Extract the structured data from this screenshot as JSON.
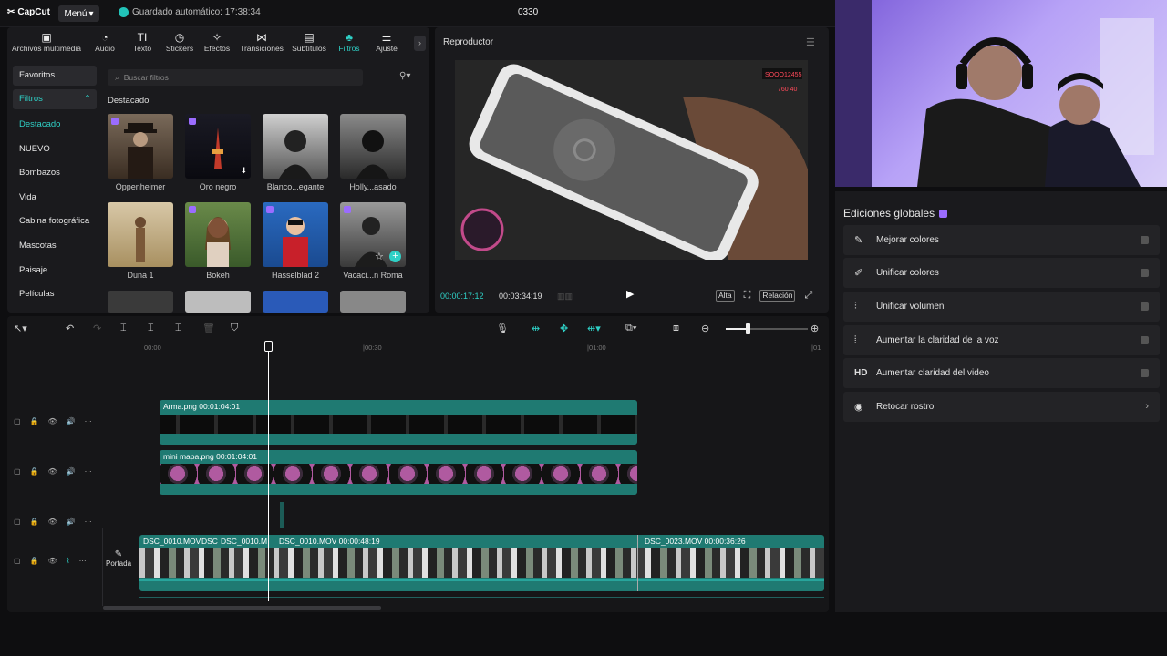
{
  "app": {
    "logo": "CapCut",
    "menu": "Menú",
    "save_status": "Guardado automático: 17:38:34",
    "project": "0330"
  },
  "toolbar": [
    {
      "label": "Archivos multimedia",
      "icon": "media-icon"
    },
    {
      "label": "Audio",
      "icon": "audio-icon"
    },
    {
      "label": "Texto",
      "icon": "text-icon"
    },
    {
      "label": "Stickers",
      "icon": "sticker-icon"
    },
    {
      "label": "Efectos",
      "icon": "effects-icon"
    },
    {
      "label": "Transiciones",
      "icon": "transition-icon"
    },
    {
      "label": "Subtítulos",
      "icon": "subtitle-icon"
    },
    {
      "label": "Filtros",
      "icon": "filter-icon"
    },
    {
      "label": "Ajuste",
      "icon": "adjust-icon"
    }
  ],
  "sidebar": [
    "Favoritos",
    "Filtros",
    "Destacado",
    "NUEVO",
    "Bombazos",
    "Vida",
    "Cabina fotográfica",
    "Mascotas",
    "Paisaje",
    "Películas"
  ],
  "search_placeholder": "Buscar filtros",
  "section_title": "Destacado",
  "filters": [
    "Oppenheimer",
    "Oro negro",
    "Blanco...egante",
    "Holly...asado",
    "Duna 1",
    "Bokeh",
    "Hasselblad 2",
    "Vacaci...n Roma"
  ],
  "player": {
    "title": "Reproductor",
    "current": "00:00:17:12",
    "total": "00:03:34:19",
    "quality": "Alta",
    "ratio": "Relación",
    "overlay_top": "SOOO12455",
    "overlay_sub": "760 40"
  },
  "ruler": [
    "00:00",
    "|00:30",
    "|01:00",
    "|01"
  ],
  "tracks": {
    "arma": "Arma.png  00:01:04:01",
    "mapa": "mini mapa.png  00:01:04:01",
    "main_clips": [
      "DSC_0010.MOV",
      "DSC",
      "DSC_0010.M",
      "DSC_0010.MOV  00:00:48:19",
      "DSC_0023.MOV  00:00:36:26"
    ],
    "cover": "Portada"
  },
  "global": {
    "title": "Ediciones globales",
    "items": [
      {
        "label": "Mejorar colores",
        "icon": "wand-icon"
      },
      {
        "label": "Unificar colores",
        "icon": "palette-icon"
      },
      {
        "label": "Unificar volumen",
        "icon": "sliders-icon"
      },
      {
        "label": "Aumentar la claridad de la voz",
        "icon": "voice-icon"
      },
      {
        "label": "Aumentar claridad del video",
        "icon": "hd-icon",
        "icon_text": "HD"
      },
      {
        "label": "Retocar rostro",
        "icon": "face-icon"
      }
    ]
  },
  "colors": {
    "accent": "#2fd0c6",
    "clip": "#1f7a72",
    "panel": "#1a1a1d"
  }
}
